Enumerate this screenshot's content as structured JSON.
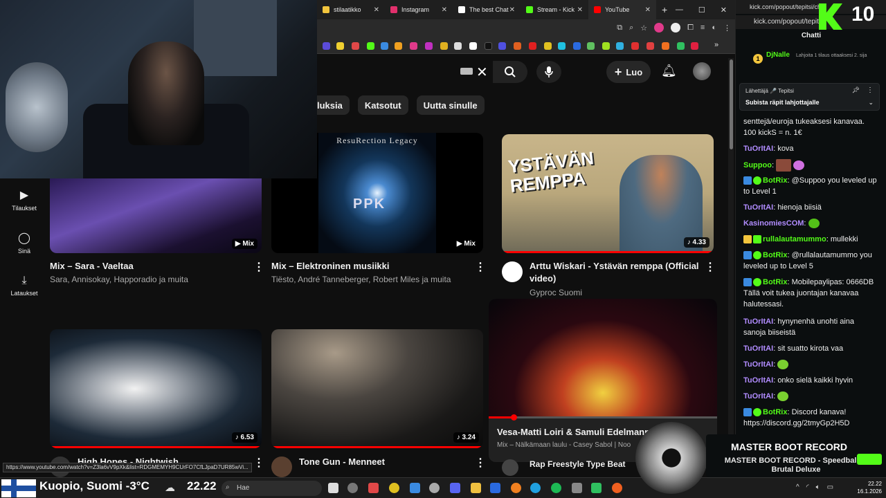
{
  "browser": {
    "tabs": [
      {
        "label": "stilaatikko",
        "color": "#f2c53d"
      },
      {
        "label": "Instagram",
        "color": "#e1306c"
      },
      {
        "label": "The best Chat",
        "color": "#ffffff"
      },
      {
        "label": "Stream - Kick",
        "color": "#53fc18"
      },
      {
        "label": "YouTube",
        "color": "#ff0000"
      }
    ],
    "tab_close": "✕",
    "new_tab": "+",
    "window_buttons": [
      "—",
      "☐",
      "✕"
    ]
  },
  "youtube": {
    "chips": [
      "luksia",
      "Katsotut",
      "Uutta sinulle"
    ],
    "create_label": "Luo",
    "sidebar": [
      {
        "label": "Tilaukset",
        "icon": "subscriptions-icon",
        "glyph": "▶"
      },
      {
        "label": "Sinä",
        "icon": "profile-icon",
        "glyph": "◯"
      },
      {
        "label": "Lataukset",
        "icon": "download-icon",
        "glyph": "⤓"
      }
    ],
    "videos": [
      {
        "title": "Mix – Sara - Vaeltaa",
        "sub": "Sara, Annisokay, Happoradio ja muita",
        "badge": "Mix"
      },
      {
        "title": "Mix – Elektroninen musiikki",
        "sub": "Tiësto, André Tanneberger, Robert Miles ja muita",
        "badge": "Mix",
        "thumb_text": "ResuRection Legacy",
        "logo": "PPK"
      },
      {
        "title": "Arttu Wiskari - Ystävän remppa (Official video)",
        "sub": "Gyproc Suomi",
        "badge": "4.33",
        "thumb_text": "YSTÄVÄN REMPPA"
      },
      {
        "title": "Vesa-Matti Loiri & Samuli Edelmann - Tuo",
        "sub": "Mix – Nälkämaan laulu - Casey Sabol | Noo"
      },
      {
        "title": "High Hopes - Nightwish",
        "badge": "6.53"
      },
      {
        "title": "Tone Gun - Menneet",
        "badge": "3.24"
      },
      {
        "title": "Rap Freestyle Type Beat"
      }
    ],
    "status_url": "https://www.youtube.com/watch?v=Z3la6vV9pXk&list=RDGMEMYH9CUrFO7CfLJpaD7UR85wVi..."
  },
  "chat": {
    "tab_url": "kick.com/popout/tepitsi/ch...",
    "url": "kick.com/popout/tepitsi",
    "title": "Chatti",
    "viewer_count": "10",
    "gifter": {
      "rank": "1",
      "name": "DjNalle",
      "sub": "Lahjoita 1 tilaus ottaaksesi 2. sija"
    },
    "pinned": {
      "line1": "Lähettäjä 🎤 Tepitsi",
      "line2": "Subista räpit lahjottajalle"
    },
    "messages": [
      {
        "user": "",
        "text": "senttejä/euroja tukeaksesi kanavaa. 100 kickS = n. 1€",
        "color": "#eeeeee"
      },
      {
        "user": "TuOrItAI",
        "text": "kova",
        "color": "#b18cff"
      },
      {
        "user": "Suppoo",
        "text": "",
        "color": "#53fc18"
      },
      {
        "user": "BotRix",
        "text": "@Suppoo you leveled up to Level 1",
        "color": "#53fc18"
      },
      {
        "user": "TuOrItAI",
        "text": "hienoja biisiä",
        "color": "#b18cff"
      },
      {
        "user": "KasinomiesCOM",
        "text": "",
        "color": "#b18cff"
      },
      {
        "user": "rullalautamummo",
        "text": "mullekki",
        "color": "#53fc18"
      },
      {
        "user": "BotRix",
        "text": "@rullalautamummo you leveled up to Level 5",
        "color": "#53fc18"
      },
      {
        "user": "BotRix",
        "text": "Mobilepaylipas: 0666DB Tällä voit tukea juontajan kanavaa halutessasi.",
        "color": "#53fc18"
      },
      {
        "user": "TuOrItAI",
        "text": "hynynenhä unohti aina sanoja biiseistä",
        "color": "#b18cff"
      },
      {
        "user": "TuOrItAI",
        "text": "sit suatto kirota vaa",
        "color": "#b18cff"
      },
      {
        "user": "TuOrItAI",
        "text": "",
        "color": "#b18cff"
      },
      {
        "user": "TuOrItAI",
        "text": "onko sielä kaikki hyvin",
        "color": "#b18cff"
      },
      {
        "user": "TuOrItAI",
        "text": "",
        "color": "#b18cff"
      },
      {
        "user": "BotRix",
        "text": "Discord kanava! https://discord.gg/2tmyGp2H5D",
        "color": "#53fc18"
      }
    ]
  },
  "now_playing": {
    "title": "MASTER BOOT RECORD",
    "subtitle": "MASTER BOOT RECORD - Speedball 2: Brutal Deluxe"
  },
  "taskbar": {
    "weather": "Kuopio, Suomi -3°C",
    "big_time": "22.22",
    "search_placeholder": "Hae",
    "clock_time": "22.22",
    "clock_date": "16.1.2026"
  },
  "colors": {
    "kick_green": "#53fc18",
    "yt_red": "#ff0000"
  }
}
